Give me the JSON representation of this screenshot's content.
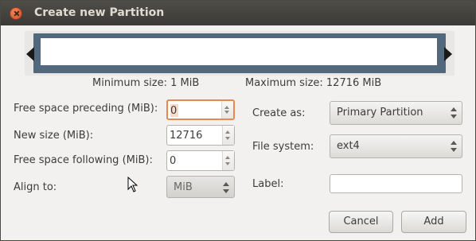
{
  "window": {
    "title": "Create new Partition"
  },
  "partition_visual": {
    "bar_color": "#52687d"
  },
  "sizes": {
    "minimum": "Minimum size: 1 MiB",
    "maximum": "Maximum size: 12716 MiB"
  },
  "left_form": {
    "free_preceding_label": "Free space preceding (MiB):",
    "free_preceding_value": "0",
    "new_size_label": "New size (MiB):",
    "new_size_value": "12716",
    "free_following_label": "Free space following (MiB):",
    "free_following_value": "0",
    "align_label": "Align to:",
    "align_value": "MiB"
  },
  "right_form": {
    "create_as_label": "Create as:",
    "create_as_value": "Primary Partition",
    "file_system_label": "File system:",
    "file_system_value": "ext4",
    "label_label": "Label:",
    "label_value": ""
  },
  "buttons": {
    "cancel": "Cancel",
    "add": "Add"
  },
  "icons": {
    "close": "close-icon",
    "left_handle": "left-arrow-icon",
    "right_handle": "right-arrow-icon",
    "pointer": "mouse-pointer-icon"
  },
  "colors": {
    "titlebar": "#3b3a36",
    "focus": "#e08a55",
    "close": "#d34d24"
  }
}
